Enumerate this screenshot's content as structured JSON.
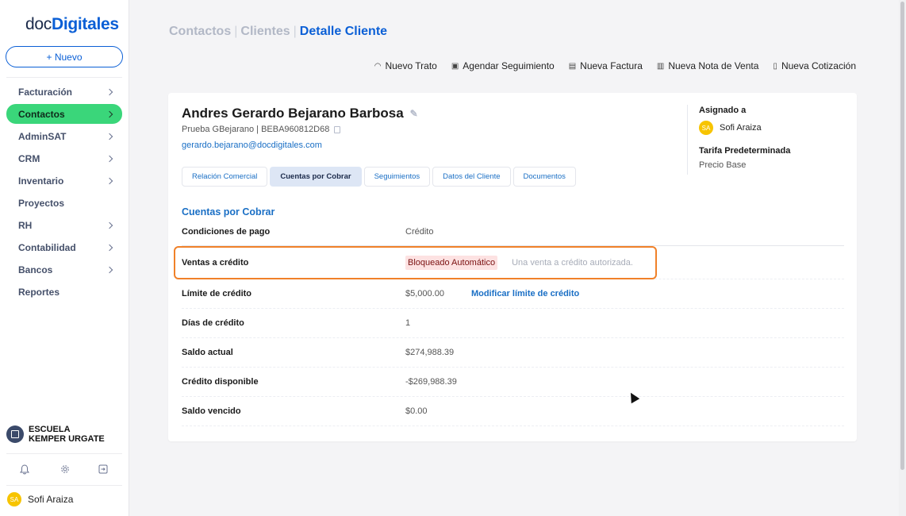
{
  "logo": {
    "part1": "doc",
    "part2": "Digitales"
  },
  "sidebar": {
    "new_label": "+ Nuevo",
    "items": [
      {
        "label": "Facturación",
        "has_arrow": true,
        "active": false
      },
      {
        "label": "Contactos",
        "has_arrow": true,
        "active": true
      },
      {
        "label": "AdminSAT",
        "has_arrow": true,
        "active": false
      },
      {
        "label": "CRM",
        "has_arrow": true,
        "active": false
      },
      {
        "label": "Inventario",
        "has_arrow": true,
        "active": false
      },
      {
        "label": "Proyectos",
        "has_arrow": false,
        "active": false
      },
      {
        "label": "RH",
        "has_arrow": true,
        "active": false
      },
      {
        "label": "Contabilidad",
        "has_arrow": true,
        "active": false
      },
      {
        "label": "Bancos",
        "has_arrow": true,
        "active": false
      },
      {
        "label": "Reportes",
        "has_arrow": false,
        "active": false
      }
    ],
    "company": "ESCUELA KEMPER URGATE",
    "user_initials": "SA",
    "user_name": "Sofi Araiza"
  },
  "breadcrumb": {
    "part1": "Contactos",
    "part2": "Clientes",
    "current": "Detalle Cliente",
    "sep": "|"
  },
  "actions": [
    "Nuevo Trato",
    "Agendar Seguimiento",
    "Nueva Factura",
    "Nueva Nota de Venta",
    "Nueva Cotización"
  ],
  "client": {
    "name": "Andres Gerardo Bejarano Barbosa",
    "subtitle": "Prueba GBejarano | BEBA960812D68",
    "email": "gerardo.bejarano@docdigitales.com"
  },
  "tabs": [
    "Relación Comercial",
    "Cuentas por Cobrar",
    "Seguimientos",
    "Datos del Cliente",
    "Documentos"
  ],
  "assigned": {
    "label": "Asignado a",
    "initials": "SA",
    "name": "Sofi Araiza",
    "tariff_label": "Tarifa Predeterminada",
    "tariff_value": "Precio Base"
  },
  "section": {
    "title": "Cuentas por Cobrar",
    "payment_terms": {
      "label": "Condiciones de pago",
      "value": "Crédito"
    },
    "credit_sales": {
      "label": "Ventas a crédito",
      "status": "Bloqueado Automático",
      "note": "Una venta a crédito autorizada."
    },
    "credit_limit": {
      "label": "Límite de crédito",
      "value": "$5,000.00",
      "link": "Modificar límite de crédito"
    },
    "credit_days": {
      "label": "Días de crédito",
      "value": "1"
    },
    "current_balance": {
      "label": "Saldo actual",
      "value": "$274,988.39"
    },
    "available_credit": {
      "label": "Crédito disponible",
      "value": "-$269,988.39"
    },
    "overdue_balance": {
      "label": "Saldo vencido",
      "value": "$0.00"
    }
  },
  "colors": {
    "accent": "#0a5fd6",
    "active_menu": "#3ad67a",
    "highlight_border": "#f08129",
    "negative": "#e0374b"
  },
  "icons": [
    "bell-icon",
    "gear-icon",
    "logout-icon",
    "building-icon",
    "pencil-icon",
    "copy-icon"
  ]
}
